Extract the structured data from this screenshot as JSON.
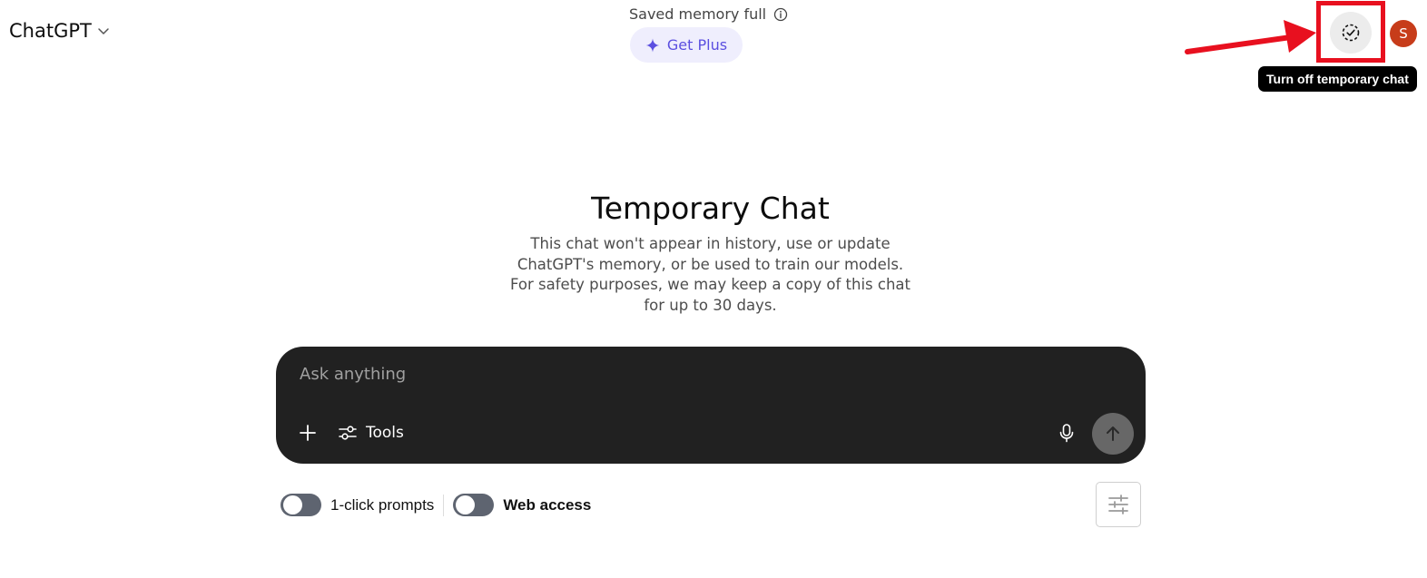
{
  "header": {
    "model_name": "ChatGPT",
    "memory_status": "Saved memory full",
    "upgrade_label": "Get Plus",
    "avatar_initial": "S",
    "tooltip": "Turn off temporary chat"
  },
  "main": {
    "title": "Temporary Chat",
    "description_lines": [
      "This chat won't appear in history, use or update",
      "ChatGPT's memory, or be used to train our models.",
      "For safety purposes, we may keep a copy of this chat",
      "for up to 30 days."
    ]
  },
  "composer": {
    "placeholder": "Ask anything",
    "value": "",
    "tools_label": "Tools"
  },
  "toggles": [
    {
      "label": "1-click prompts",
      "on": false
    },
    {
      "label": "Web access",
      "on": false
    }
  ],
  "icons": {
    "model_chevron": "chevron-down-icon",
    "memory_info": "info-icon",
    "upgrade": "sparkle-icon",
    "temporary_chat": "dashed-circle-check-icon",
    "add": "plus-icon",
    "tools": "sliders-icon",
    "mic": "microphone-icon",
    "send": "arrow-up-icon",
    "settings": "adjustments-icon"
  },
  "colors": {
    "accent": "#5b4fe0",
    "accent_bg": "#efeefd",
    "composer_bg": "#212121",
    "avatar_bg": "#c73c1a",
    "highlight": "#e8101f"
  }
}
